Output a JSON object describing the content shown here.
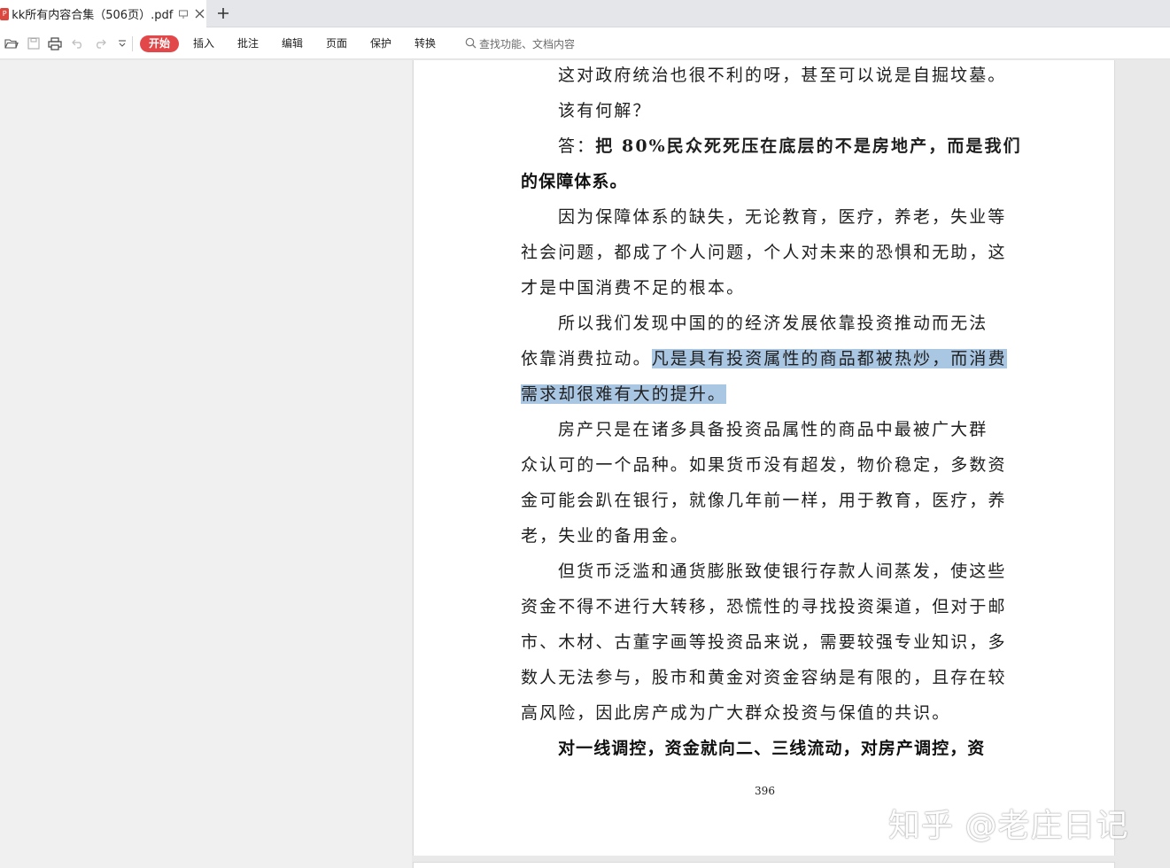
{
  "tab": {
    "badge": "P",
    "title": "kk所有内容合集（506页）.pdf"
  },
  "toolbar": {
    "menu": [
      "开始",
      "插入",
      "批注",
      "编辑",
      "页面",
      "保护",
      "转换"
    ],
    "active_menu": "开始",
    "search_placeholder": "查找功能、文档内容"
  },
  "document": {
    "lines": [
      {
        "segments": [
          {
            "text": "这对政府统治也很不利的呀，甚至可以说是自掘坟墓。"
          }
        ],
        "indent": true
      },
      {
        "segments": [
          {
            "text": "该有何解？"
          }
        ],
        "indent": true
      },
      {
        "segments": [
          {
            "text": "答：",
            "bold": false
          },
          {
            "text": "把 80%民众死死压在底层的不是房地产，而是我们",
            "bold": true
          }
        ],
        "indent": true
      },
      {
        "segments": [
          {
            "text": "的保障体系。",
            "bold": true
          }
        ],
        "indent": false
      },
      {
        "segments": [
          {
            "text": "因为保障体系的缺失，无论教育，医疗，养老，失业等"
          }
        ],
        "indent": true
      },
      {
        "segments": [
          {
            "text": "社会问题，都成了个人问题，个人对未来的恐惧和无助，这"
          }
        ],
        "indent": false
      },
      {
        "segments": [
          {
            "text": "才是中国消费不足的根本。"
          }
        ],
        "indent": false
      },
      {
        "segments": [
          {
            "text": "所以我们发现中国的的经济发展依靠投资推动而无法"
          }
        ],
        "indent": true
      },
      {
        "segments": [
          {
            "text": "依靠消费拉动。"
          },
          {
            "text": "凡是具有投资属性的商品都被热炒，而消费",
            "highlight": true
          }
        ],
        "indent": false
      },
      {
        "segments": [
          {
            "text": "需求却很难有大的提升。",
            "highlight": true
          }
        ],
        "indent": false
      },
      {
        "segments": [
          {
            "text": "房产只是在诸多具备投资品属性的商品中最被广大群"
          }
        ],
        "indent": true
      },
      {
        "segments": [
          {
            "text": "众认可的一个品种。如果货币没有超发，物价稳定，多数资"
          }
        ],
        "indent": false
      },
      {
        "segments": [
          {
            "text": "金可能会趴在银行，就像几年前一样，用于教育，医疗，养"
          }
        ],
        "indent": false
      },
      {
        "segments": [
          {
            "text": "老，失业的备用金。"
          }
        ],
        "indent": false
      },
      {
        "segments": [
          {
            "text": "但货币泛滥和通货膨胀致使银行存款人间蒸发，使这些"
          }
        ],
        "indent": true
      },
      {
        "segments": [
          {
            "text": "资金不得不进行大转移，恐慌性的寻找投资渠道，但对于邮"
          }
        ],
        "indent": false
      },
      {
        "segments": [
          {
            "text": "市、木材、古董字画等投资品来说，需要较强专业知识，多"
          }
        ],
        "indent": false
      },
      {
        "segments": [
          {
            "text": "数人无法参与，股市和黄金对资金容纳是有限的，且存在较"
          }
        ],
        "indent": false
      },
      {
        "segments": [
          {
            "text": "高风险，因此房产成为广大群众投资与保值的共识。"
          }
        ],
        "indent": false
      },
      {
        "segments": [
          {
            "text": "对一线调控，资金就向二、三线流动，对房产调控，资",
            "bold": true
          }
        ],
        "indent": true
      }
    ],
    "page_number": "396"
  },
  "watermark": "知乎 @老庄日记",
  "colors": {
    "accent": "#e2474a",
    "highlight": "#a9c6e3",
    "pdf_badge": "#d9473f"
  }
}
